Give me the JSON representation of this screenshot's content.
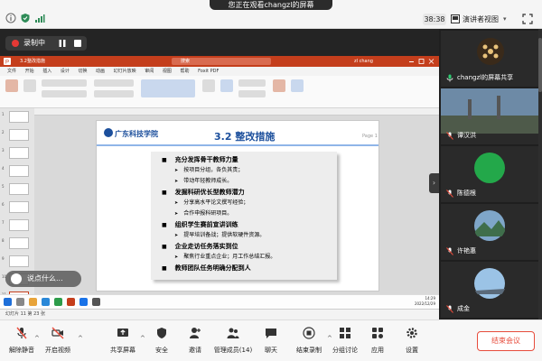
{
  "colors": {
    "accent_red": "#e74c3c",
    "ppt_red": "#c43e1c",
    "slide_blue": "#1c4f9c",
    "rec_red": "#e53935"
  },
  "header": {
    "viewing_banner": "您正在观看changzl的屏幕",
    "timer": "38:38",
    "view_mode": "演讲者视图",
    "view_mode_arrow": "▾"
  },
  "recording": {
    "label": "录制中"
  },
  "ppt": {
    "doc_title": "3.2整改措施",
    "search": "搜索",
    "user": "zl chang",
    "menu": [
      "文件",
      "开始",
      "插入",
      "设计",
      "切换",
      "动画",
      "幻灯片放映",
      "审阅",
      "视图",
      "帮助",
      "Foxit PDF"
    ],
    "thumb_numbers": [
      "1",
      "2",
      "3",
      "4",
      "5",
      "6",
      "7",
      "8",
      "9",
      "10",
      "11"
    ],
    "status_left": "幻灯片 11 第 23 张"
  },
  "slide": {
    "college": "广东科技学院",
    "section_title": "3.2 整改措施",
    "page_label": "Page 1",
    "items": [
      {
        "type": "main",
        "text": "充分发挥骨干教师力量"
      },
      {
        "type": "sub",
        "text": "按项目分组，各负其责；"
      },
      {
        "type": "sub",
        "text": "带动年轻教师成长。"
      },
      {
        "type": "main",
        "text": "发掘科研优长型教师潜力"
      },
      {
        "type": "sub",
        "text": "分享高水平论文撰写经验；"
      },
      {
        "type": "sub",
        "text": "合作申报科研项目。"
      },
      {
        "type": "main",
        "text": "组织学生赛前宣讲训练"
      },
      {
        "type": "sub",
        "text": "提早培训备战；提供软硬件资源。"
      },
      {
        "type": "main",
        "text": "企业走访任务落实到位"
      },
      {
        "type": "sub",
        "text": "聚焦行业重点企业；月工作总结汇报。"
      },
      {
        "type": "main",
        "text": "教师团队任务明确分配到人"
      }
    ]
  },
  "speech_overlay": {
    "text": "说点什么..."
  },
  "taskbar": {
    "tray_line1": "14:29",
    "tray_line2": "2022/12/29"
  },
  "participants": [
    {
      "name": "changzl的屏幕共享",
      "avatar": "screen-share-avatar"
    },
    {
      "name": "谭汉洪",
      "avatar": "photo-avatar"
    },
    {
      "name": "陈德根",
      "avatar": "green-circle-avatar"
    },
    {
      "name": "许艳惠",
      "avatar": "landscape-avatar"
    },
    {
      "name": "成金",
      "avatar": "sky-avatar"
    },
    {
      "name": "",
      "avatar": "sky-avatar"
    }
  ],
  "toolbar": {
    "buttons": [
      {
        "label": "解除静音",
        "icon": "mic-muted-icon"
      },
      {
        "label": "开启视频",
        "icon": "video-off-icon"
      },
      {
        "label": "共享屏幕",
        "icon": "share-screen-icon"
      },
      {
        "label": "安全",
        "icon": "shield-icon"
      },
      {
        "label": "邀请",
        "icon": "invite-icon"
      },
      {
        "label": "管理成员(14)",
        "icon": "members-icon"
      },
      {
        "label": "聊天",
        "icon": "chat-icon"
      },
      {
        "label": "结束录制",
        "icon": "stop-record-icon"
      },
      {
        "label": "分组讨论",
        "icon": "breakout-icon"
      },
      {
        "label": "应用",
        "icon": "apps-icon"
      },
      {
        "label": "设置",
        "icon": "gear-icon"
      }
    ],
    "end_meeting": "结束会议"
  }
}
